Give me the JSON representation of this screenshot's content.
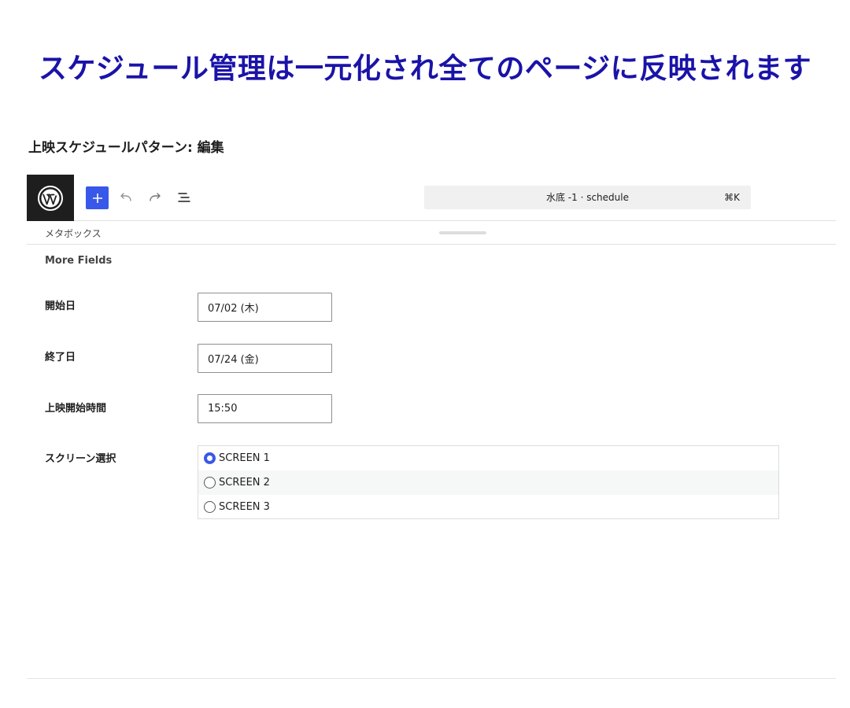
{
  "headline": "スケジュール管理は一元化され全てのページに反映されます",
  "page_title": "上映スケジュールパターン: 編集",
  "toolbar": {
    "logo_icon": "wordpress-logo-icon",
    "add_icon": "plus-icon",
    "undo_icon": "undo-icon",
    "redo_icon": "redo-icon",
    "outline_icon": "document-outline-icon",
    "command_label": "水底 -1 · schedule",
    "command_shortcut": "⌘K"
  },
  "metabox": {
    "label": "メタボックス",
    "section_title": "More Fields"
  },
  "fields": [
    {
      "label": "開始日",
      "value": "07/02 (木)"
    },
    {
      "label": "終了日",
      "value": "07/24 (金)"
    },
    {
      "label": "上映開始時間",
      "value": "15:50"
    }
  ],
  "screen_select": {
    "label": "スクリーン選択",
    "options": [
      "SCREEN 1",
      "SCREEN 2",
      "SCREEN 3"
    ],
    "selected": "SCREEN 1"
  },
  "colors": {
    "headline": "#1a13a8",
    "accent": "#3858e9",
    "logo_bg": "#1e1e1e"
  }
}
